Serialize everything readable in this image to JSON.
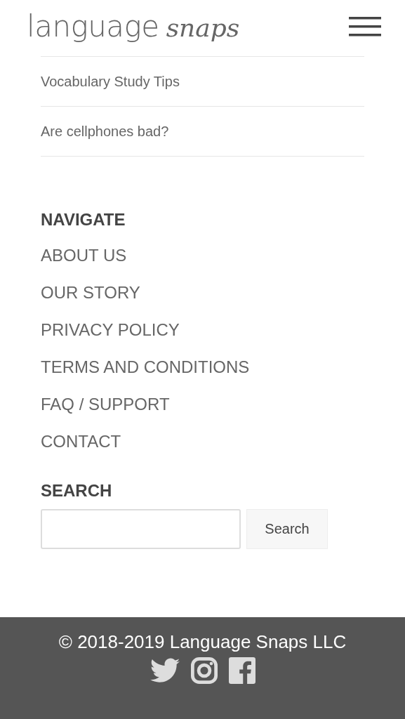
{
  "header": {
    "logo": {
      "main": "language",
      "accent": "snaps"
    }
  },
  "recent_posts": [
    {
      "title": "Vocabulary Study Tips"
    },
    {
      "title": "Are cellphones bad?"
    }
  ],
  "navigate": {
    "heading": "NAVIGATE",
    "links": [
      "ABOUT US",
      "OUR STORY",
      "PRIVACY POLICY",
      "TERMS AND CONDITIONS",
      "FAQ / SUPPORT",
      "CONTACT"
    ]
  },
  "search": {
    "heading": "SEARCH",
    "button": "Search"
  },
  "footer": {
    "copyright": "© 2018-2019 Language Snaps LLC",
    "social": [
      {
        "kind": "twitter"
      },
      {
        "kind": "instagram"
      },
      {
        "kind": "facebook"
      }
    ]
  }
}
